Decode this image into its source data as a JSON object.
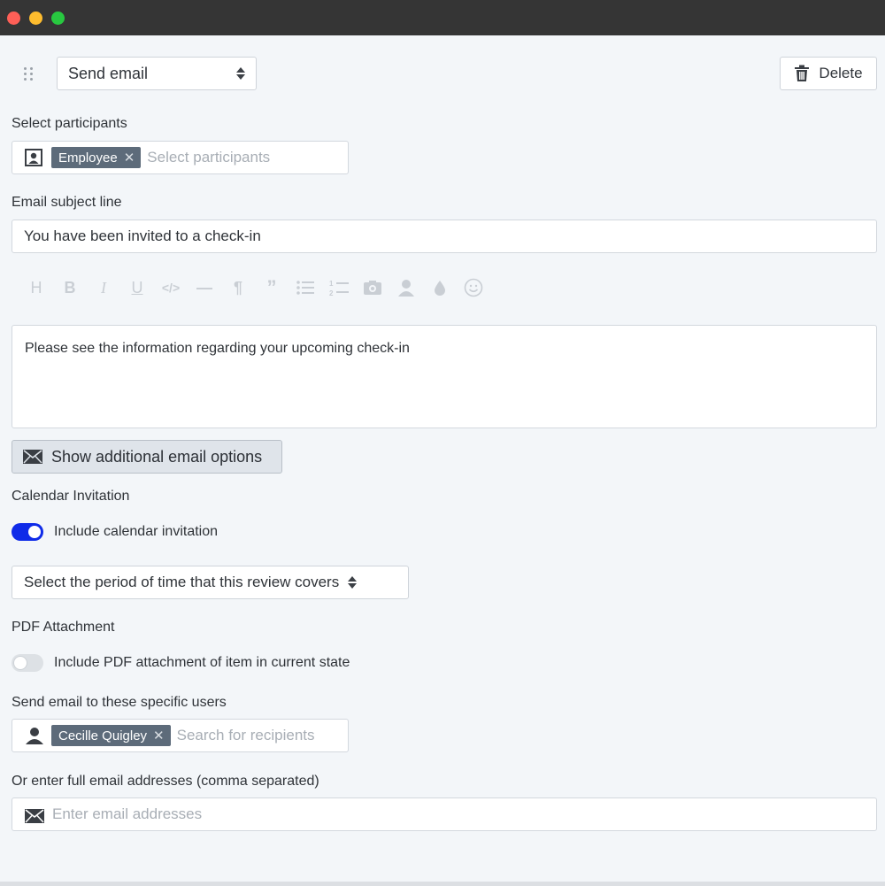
{
  "action": {
    "type_value": "Send email",
    "delete_label": "Delete"
  },
  "participants": {
    "label": "Select participants",
    "chips": [
      "Employee"
    ],
    "placeholder": "Select participants"
  },
  "subject": {
    "label": "Email subject line",
    "value": "You have been invited to a check-in"
  },
  "editor": {
    "toolbar": [
      "heading-icon",
      "bold-icon",
      "italic-icon",
      "underline-icon",
      "code-icon",
      "horizontal-rule-icon",
      "paragraph-icon",
      "quote-icon",
      "bullet-list-icon",
      "numbered-list-icon",
      "image-icon",
      "person-icon",
      "color-drop-icon",
      "emoji-icon"
    ],
    "body": "Please see the information regarding your upcoming check-in"
  },
  "options_button_label": "Show additional email options",
  "calendar": {
    "section_label": "Calendar Invitation",
    "toggle_label": "Include calendar invitation",
    "toggle_on": true,
    "period_value": "Select the period of time that this review covers"
  },
  "pdf": {
    "section_label": "PDF Attachment",
    "toggle_label": "Include PDF attachment of item in current state",
    "toggle_on": false
  },
  "specific_users": {
    "label": "Send email to these specific users",
    "chips": [
      "Cecille Quigley"
    ],
    "placeholder": "Search for recipients"
  },
  "email_addresses": {
    "label": "Or enter full email addresses (comma separated)",
    "placeholder": "Enter email addresses"
  },
  "colors": {
    "toggle_on": "#0f2be8",
    "chip_bg": "#5d6b7a"
  }
}
